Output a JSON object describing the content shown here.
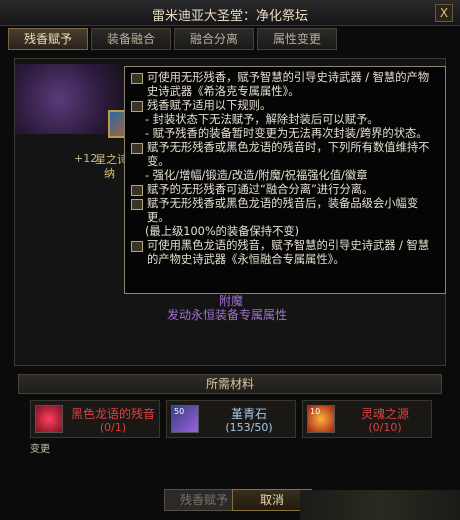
{
  "window": {
    "title": "雷米迪亚大圣堂：净化祭坛",
    "close_label": "X"
  },
  "tabs": [
    {
      "label": "残香赋予"
    },
    {
      "label": "装备融合"
    },
    {
      "label": "融合分离"
    },
    {
      "label": "属性变更"
    }
  ],
  "item": {
    "plus": "+12",
    "name": "星之诗",
    "name2": "纳"
  },
  "tooltip": {
    "lines": [
      {
        "bullet": true,
        "text": "可使用无形残香，赋予智慧的引导史诗武器 / 智慧的产物史诗武器《希洛克专属属性》。"
      },
      {
        "bullet": true,
        "text": "残香赋予适用以下规则。"
      },
      {
        "bullet": false,
        "text": "- 封装状态下无法赋予，解除封装后可以赋予。"
      },
      {
        "bullet": false,
        "text": "- 赋予残香的装备暂时变更为无法再次封装/跨界的状态。"
      },
      {
        "bullet": true,
        "text": "赋予无形残香或黑色龙语的残音时，下列所有数值维持不变。"
      },
      {
        "bullet": false,
        "text": "- 强化/增幅/锻造/改造/附魔/祝福强化值/徽章"
      },
      {
        "bullet": true,
        "text": "赋予的无形残香可通过“融合分离”进行分离。"
      },
      {
        "bullet": true,
        "text": "赋予无形残香或黑色龙语的残音后，装备品级会小幅变更。"
      },
      {
        "bullet": false,
        "text": "(最上级100%的装备保持不变)"
      },
      {
        "bullet": true,
        "text": "可使用黑色龙语的残音，赋予智慧的引导史诗武器 / 智慧的产物史诗武器《永恒融合专属属性》。"
      }
    ]
  },
  "fusion": {
    "line1": "附魔",
    "line2": "发动永恒装备专属属性"
  },
  "requirements": {
    "header": "所需材料",
    "materials": [
      {
        "name": "黑色龙语的残音",
        "count": "(0/1)",
        "color": "#e04040",
        "icon": "dragon-echo-icon",
        "stack": ""
      },
      {
        "name": "堇青石",
        "count": "(153/50)",
        "color": "#a8c8e8",
        "icon": "cordierite-icon",
        "stack": "50"
      },
      {
        "name": "灵魂之源",
        "count": "(0/10)",
        "color": "#e04040",
        "icon": "soul-source-icon",
        "stack": "10"
      }
    ],
    "changed_label": "变更"
  },
  "buttons": {
    "confirm": "残香赋予",
    "cancel": "取消"
  }
}
